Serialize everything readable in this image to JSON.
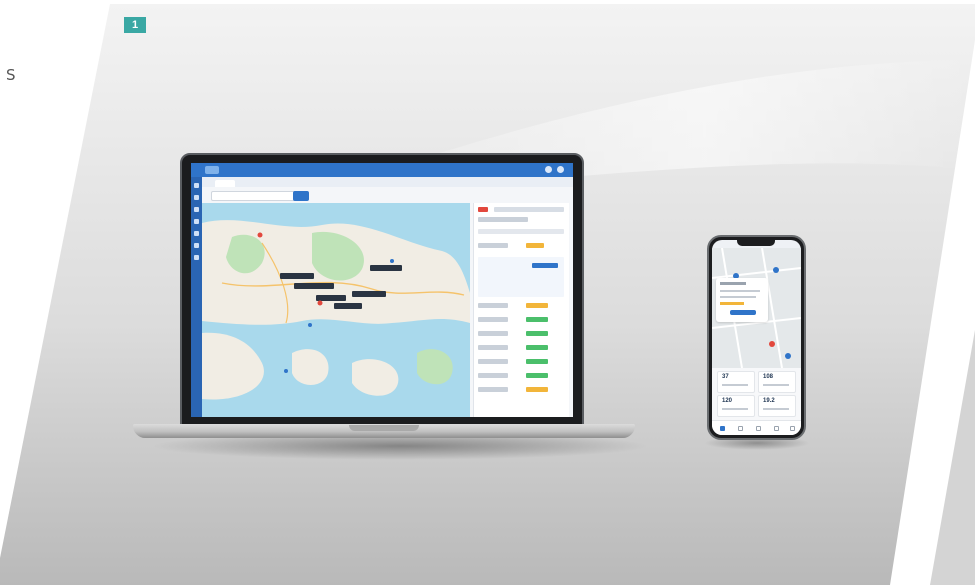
{
  "page": {
    "badge": "1",
    "side_letter": "S"
  },
  "phone": {
    "stats": [
      {
        "value": "37"
      },
      {
        "value": "108"
      },
      {
        "value": "120"
      },
      {
        "value": "19.2"
      }
    ]
  },
  "colors": {
    "accent": "#2f74c9",
    "sidebar": "#2a65b3",
    "badge": "#3aa8a4",
    "map_water": "#a9d9ec",
    "map_land": "#f1ede4",
    "map_green": "#bfe3b8"
  },
  "icons": [
    "search-icon",
    "user-icon",
    "map-pin-icon",
    "menu-icon"
  ]
}
